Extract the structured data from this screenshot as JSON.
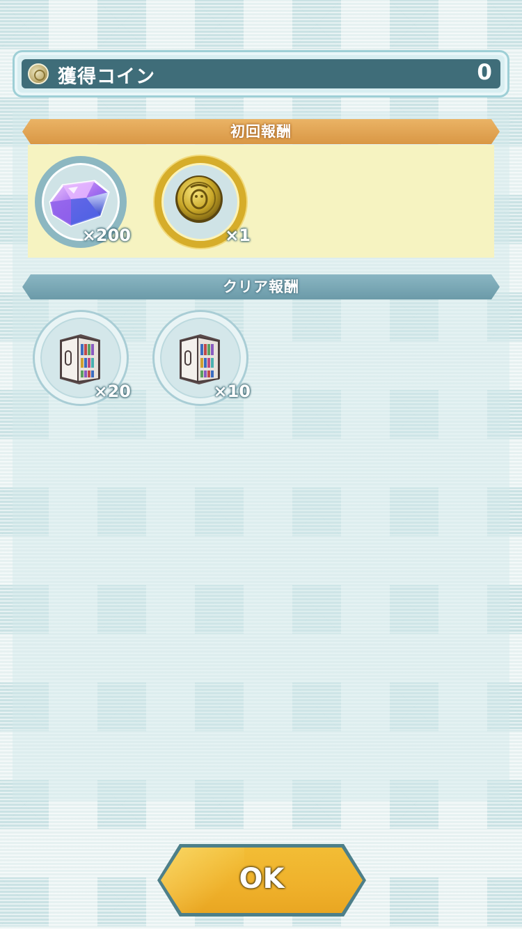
{
  "coin_bar": {
    "label": "獲得コイン",
    "value": "0",
    "icon": "coin-icon"
  },
  "first_rewards": {
    "title": "初回報酬",
    "items": [
      {
        "icon": "gem-icon",
        "quantity": "×200"
      },
      {
        "icon": "gold-coin-icon",
        "quantity": "×1"
      }
    ]
  },
  "clear_rewards": {
    "title": "クリア報酬",
    "items": [
      {
        "icon": "bookshelf-icon",
        "quantity": "×20"
      },
      {
        "icon": "bookshelf-icon",
        "quantity": "×10"
      }
    ]
  },
  "ok_button": {
    "label": "OK"
  },
  "colors": {
    "first_header": "#e0a552",
    "clear_header": "#7ea9b5",
    "first_area": "#f6f3c1",
    "coin_bar": "#3f6d79",
    "ok_button": "#f0b42f"
  }
}
